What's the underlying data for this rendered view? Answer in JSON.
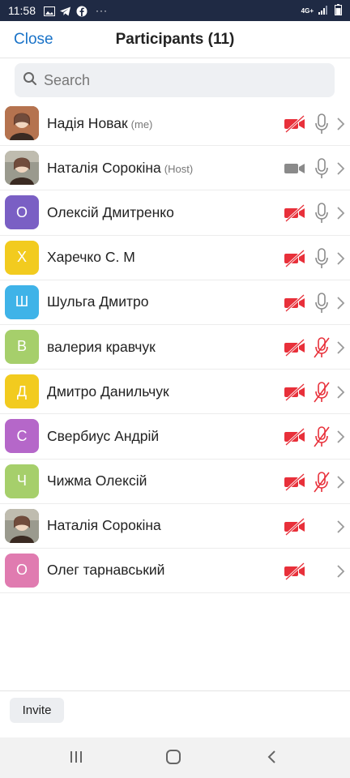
{
  "status_bar": {
    "time": "11:58",
    "dots": "···",
    "network": "4G+"
  },
  "header": {
    "close_label": "Close",
    "title": "Participants (11)"
  },
  "search": {
    "placeholder": "Search"
  },
  "colors": {
    "accent": "#1a73c8",
    "muted_red": "#e8303a",
    "gray_icon": "#8a8a8a"
  },
  "participants": [
    {
      "name": "Надія Новак",
      "role": "(me)",
      "avatar_type": "photo",
      "initial": "",
      "avatar_color": "#b5734f",
      "video": "off",
      "mic": "on"
    },
    {
      "name": "Наталія Сорокіна",
      "role": "(Host)",
      "avatar_type": "photo",
      "initial": "",
      "avatar_color": "#9a9a8e",
      "video": "on",
      "mic": "on"
    },
    {
      "name": "Олексій Дмитренко",
      "role": "",
      "avatar_type": "letter",
      "initial": "О",
      "avatar_color": "#7a5fc4",
      "video": "off",
      "mic": "on"
    },
    {
      "name": "Харечко С. М",
      "role": "",
      "avatar_type": "letter",
      "initial": "Х",
      "avatar_color": "#f2cb1f",
      "video": "off",
      "mic": "on"
    },
    {
      "name": "Шульга Дмитро",
      "role": "",
      "avatar_type": "letter",
      "initial": "Ш",
      "avatar_color": "#3fb3e8",
      "video": "off",
      "mic": "on"
    },
    {
      "name": "валерия кравчук",
      "role": "",
      "avatar_type": "letter",
      "initial": "В",
      "avatar_color": "#a6cf6b",
      "video": "off",
      "mic": "muted"
    },
    {
      "name": "Дмитро Данильчук",
      "role": "",
      "avatar_type": "letter",
      "initial": "Д",
      "avatar_color": "#f2cb1f",
      "video": "off",
      "mic": "muted"
    },
    {
      "name": "Свербиус Андрій",
      "role": "",
      "avatar_type": "letter",
      "initial": "С",
      "avatar_color": "#b567c9",
      "video": "off",
      "mic": "muted"
    },
    {
      "name": "Чижма Олексій",
      "role": "",
      "avatar_type": "letter",
      "initial": "Ч",
      "avatar_color": "#a6cf6b",
      "video": "off",
      "mic": "muted"
    },
    {
      "name": "Наталія Сорокіна",
      "role": "",
      "avatar_type": "photo",
      "initial": "",
      "avatar_color": "#9a9a8e",
      "video": "off",
      "mic": "none"
    },
    {
      "name": "Олег тарнавський",
      "role": "",
      "avatar_type": "letter",
      "initial": "О",
      "avatar_color": "#e07bb0",
      "video": "off",
      "mic": "none"
    }
  ],
  "footer": {
    "invite_label": "Invite"
  }
}
